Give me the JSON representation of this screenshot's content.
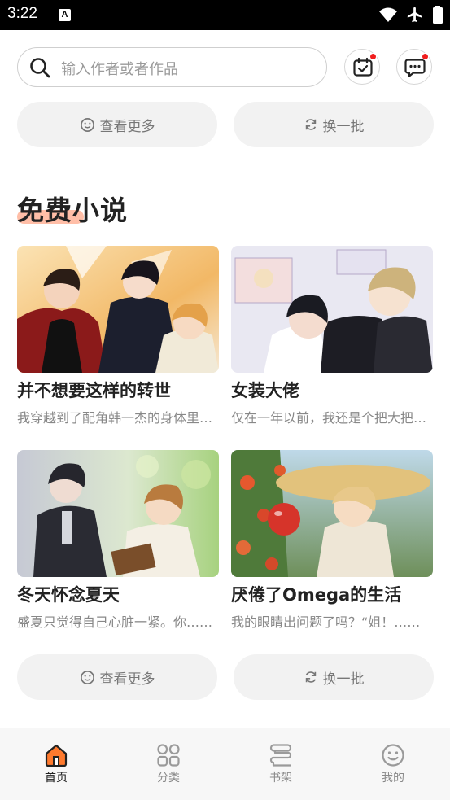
{
  "status_bar": {
    "time": "3:22",
    "notification_letter": "A"
  },
  "search": {
    "placeholder": "输入作者或者作品"
  },
  "top_actions": {
    "more_label": "查看更多",
    "refresh_label": "换一批"
  },
  "section": {
    "title": "免费小说",
    "books": [
      {
        "title": "并不想要这样的转世",
        "desc": "我穿越到了配角韩一杰的身体里……"
      },
      {
        "title": "女装大佬",
        "desc": "仅在一年以前，我还是个把大把……"
      },
      {
        "title": "冬天怀念夏天",
        "desc": "盛夏只觉得自己心脏一紧。你……"
      },
      {
        "title": "厌倦了Omega的生活",
        "desc": "我的眼睛出问题了吗？“姐！……"
      }
    ],
    "more_label": "查看更多",
    "refresh_label": "换一批"
  },
  "tabs": [
    {
      "label": "首页",
      "icon": "home-icon",
      "active": true
    },
    {
      "label": "分类",
      "icon": "grid-icon",
      "active": false
    },
    {
      "label": "书架",
      "icon": "bookshelf-icon",
      "active": false
    },
    {
      "label": "我的",
      "icon": "smile-icon",
      "active": false
    }
  ],
  "colors": {
    "accent": "#ff7a2e",
    "badge": "#f01d1d",
    "title_underline": "#ffb398"
  }
}
